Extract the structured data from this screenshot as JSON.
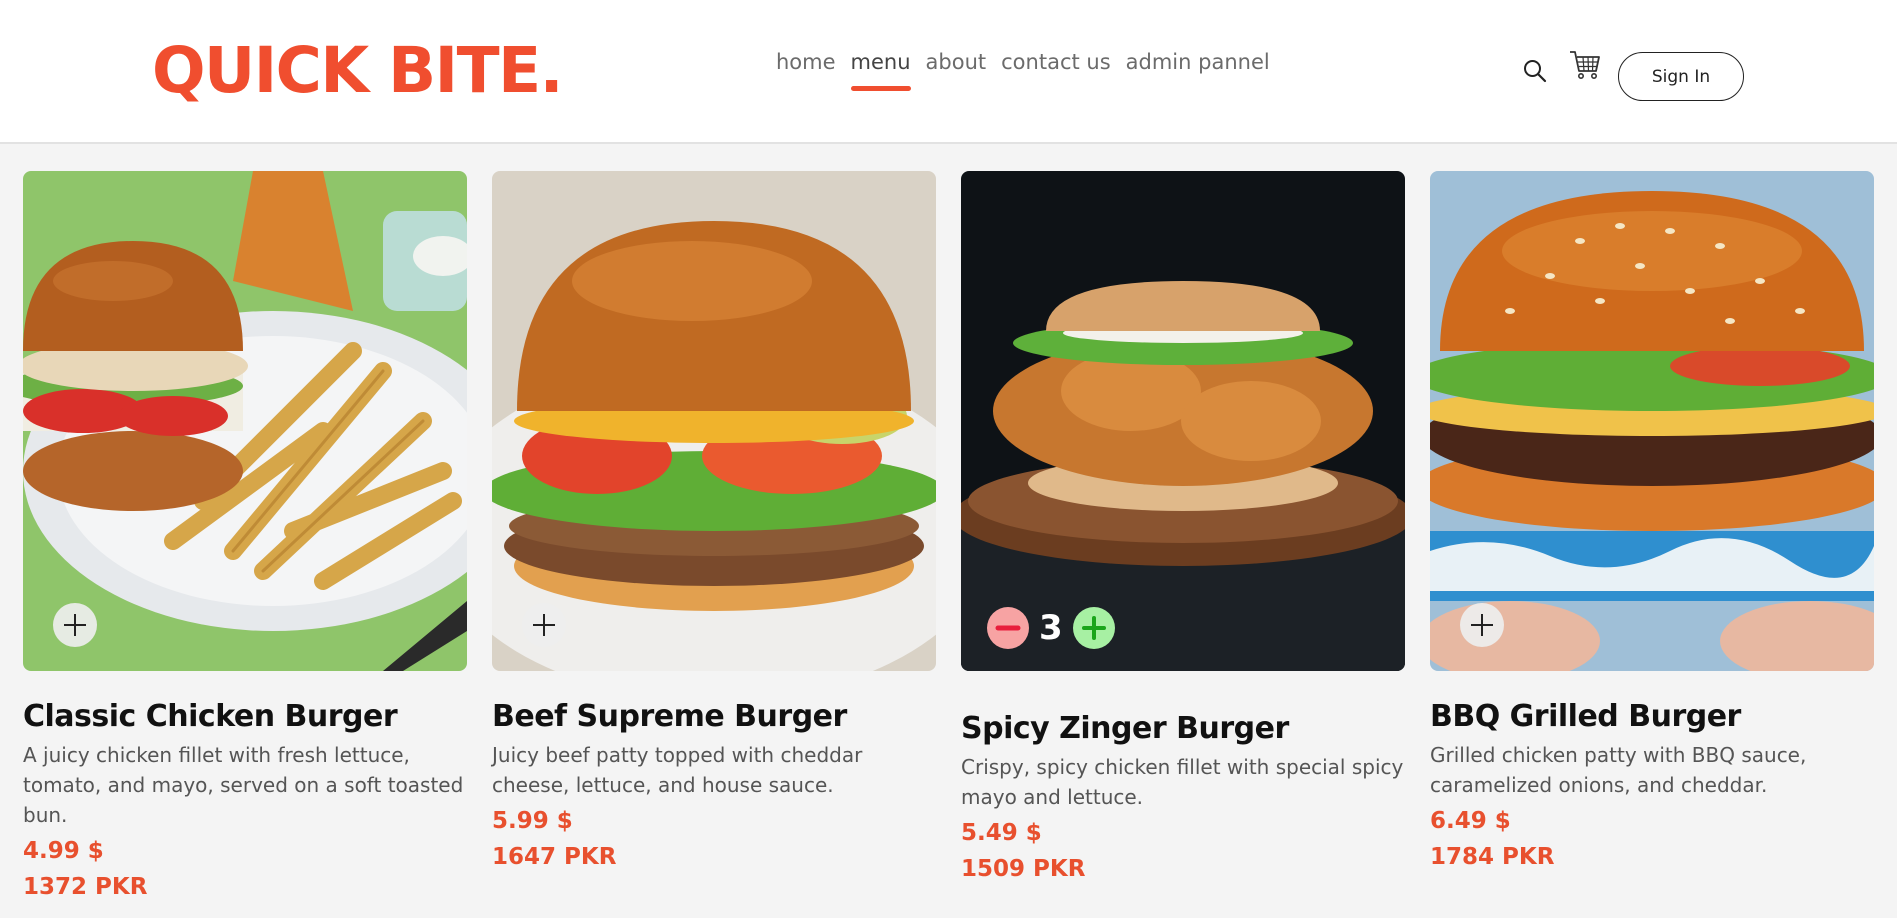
{
  "brand": {
    "name": "QUICK BITE."
  },
  "nav": {
    "items": [
      {
        "label": "home",
        "active": false
      },
      {
        "label": "menu",
        "active": true
      },
      {
        "label": "about",
        "active": false
      },
      {
        "label": "contact us",
        "active": false
      },
      {
        "label": "admin pannel",
        "active": false
      }
    ]
  },
  "header_actions": {
    "search_icon": "search-icon",
    "cart_icon": "cart-icon",
    "signin_label": "Sign In"
  },
  "menu_items": [
    {
      "title": "Classic Chicken Burger",
      "description": "A juicy chicken fillet with fresh lettuce, tomato, and mayo, served on a soft toasted bun.",
      "price_usd": "4.99 $",
      "price_pkr": "1372 PKR",
      "in_cart": false
    },
    {
      "title": "Beef Supreme Burger",
      "description": "Juicy beef patty topped with cheddar cheese, lettuce, and house sauce.",
      "price_usd": "5.99 $",
      "price_pkr": "1647 PKR",
      "in_cart": false
    },
    {
      "title": "Spicy Zinger Burger",
      "description": "Crispy, spicy chicken fillet with special spicy mayo and lettuce.",
      "price_usd": "5.49 $",
      "price_pkr": "1509 PKR",
      "in_cart": true,
      "quantity": "3"
    },
    {
      "title": "BBQ Grilled Burger",
      "description": "Grilled chicken patty with BBQ sauce, caramelized onions, and cheddar.",
      "price_usd": "6.49 $",
      "price_pkr": "1784 PKR",
      "in_cart": false
    }
  ],
  "colors": {
    "brand": "#f04e2f",
    "price": "#e8502e",
    "qty_minus": "#f7a3a3",
    "qty_plus": "#a7f0a3"
  }
}
